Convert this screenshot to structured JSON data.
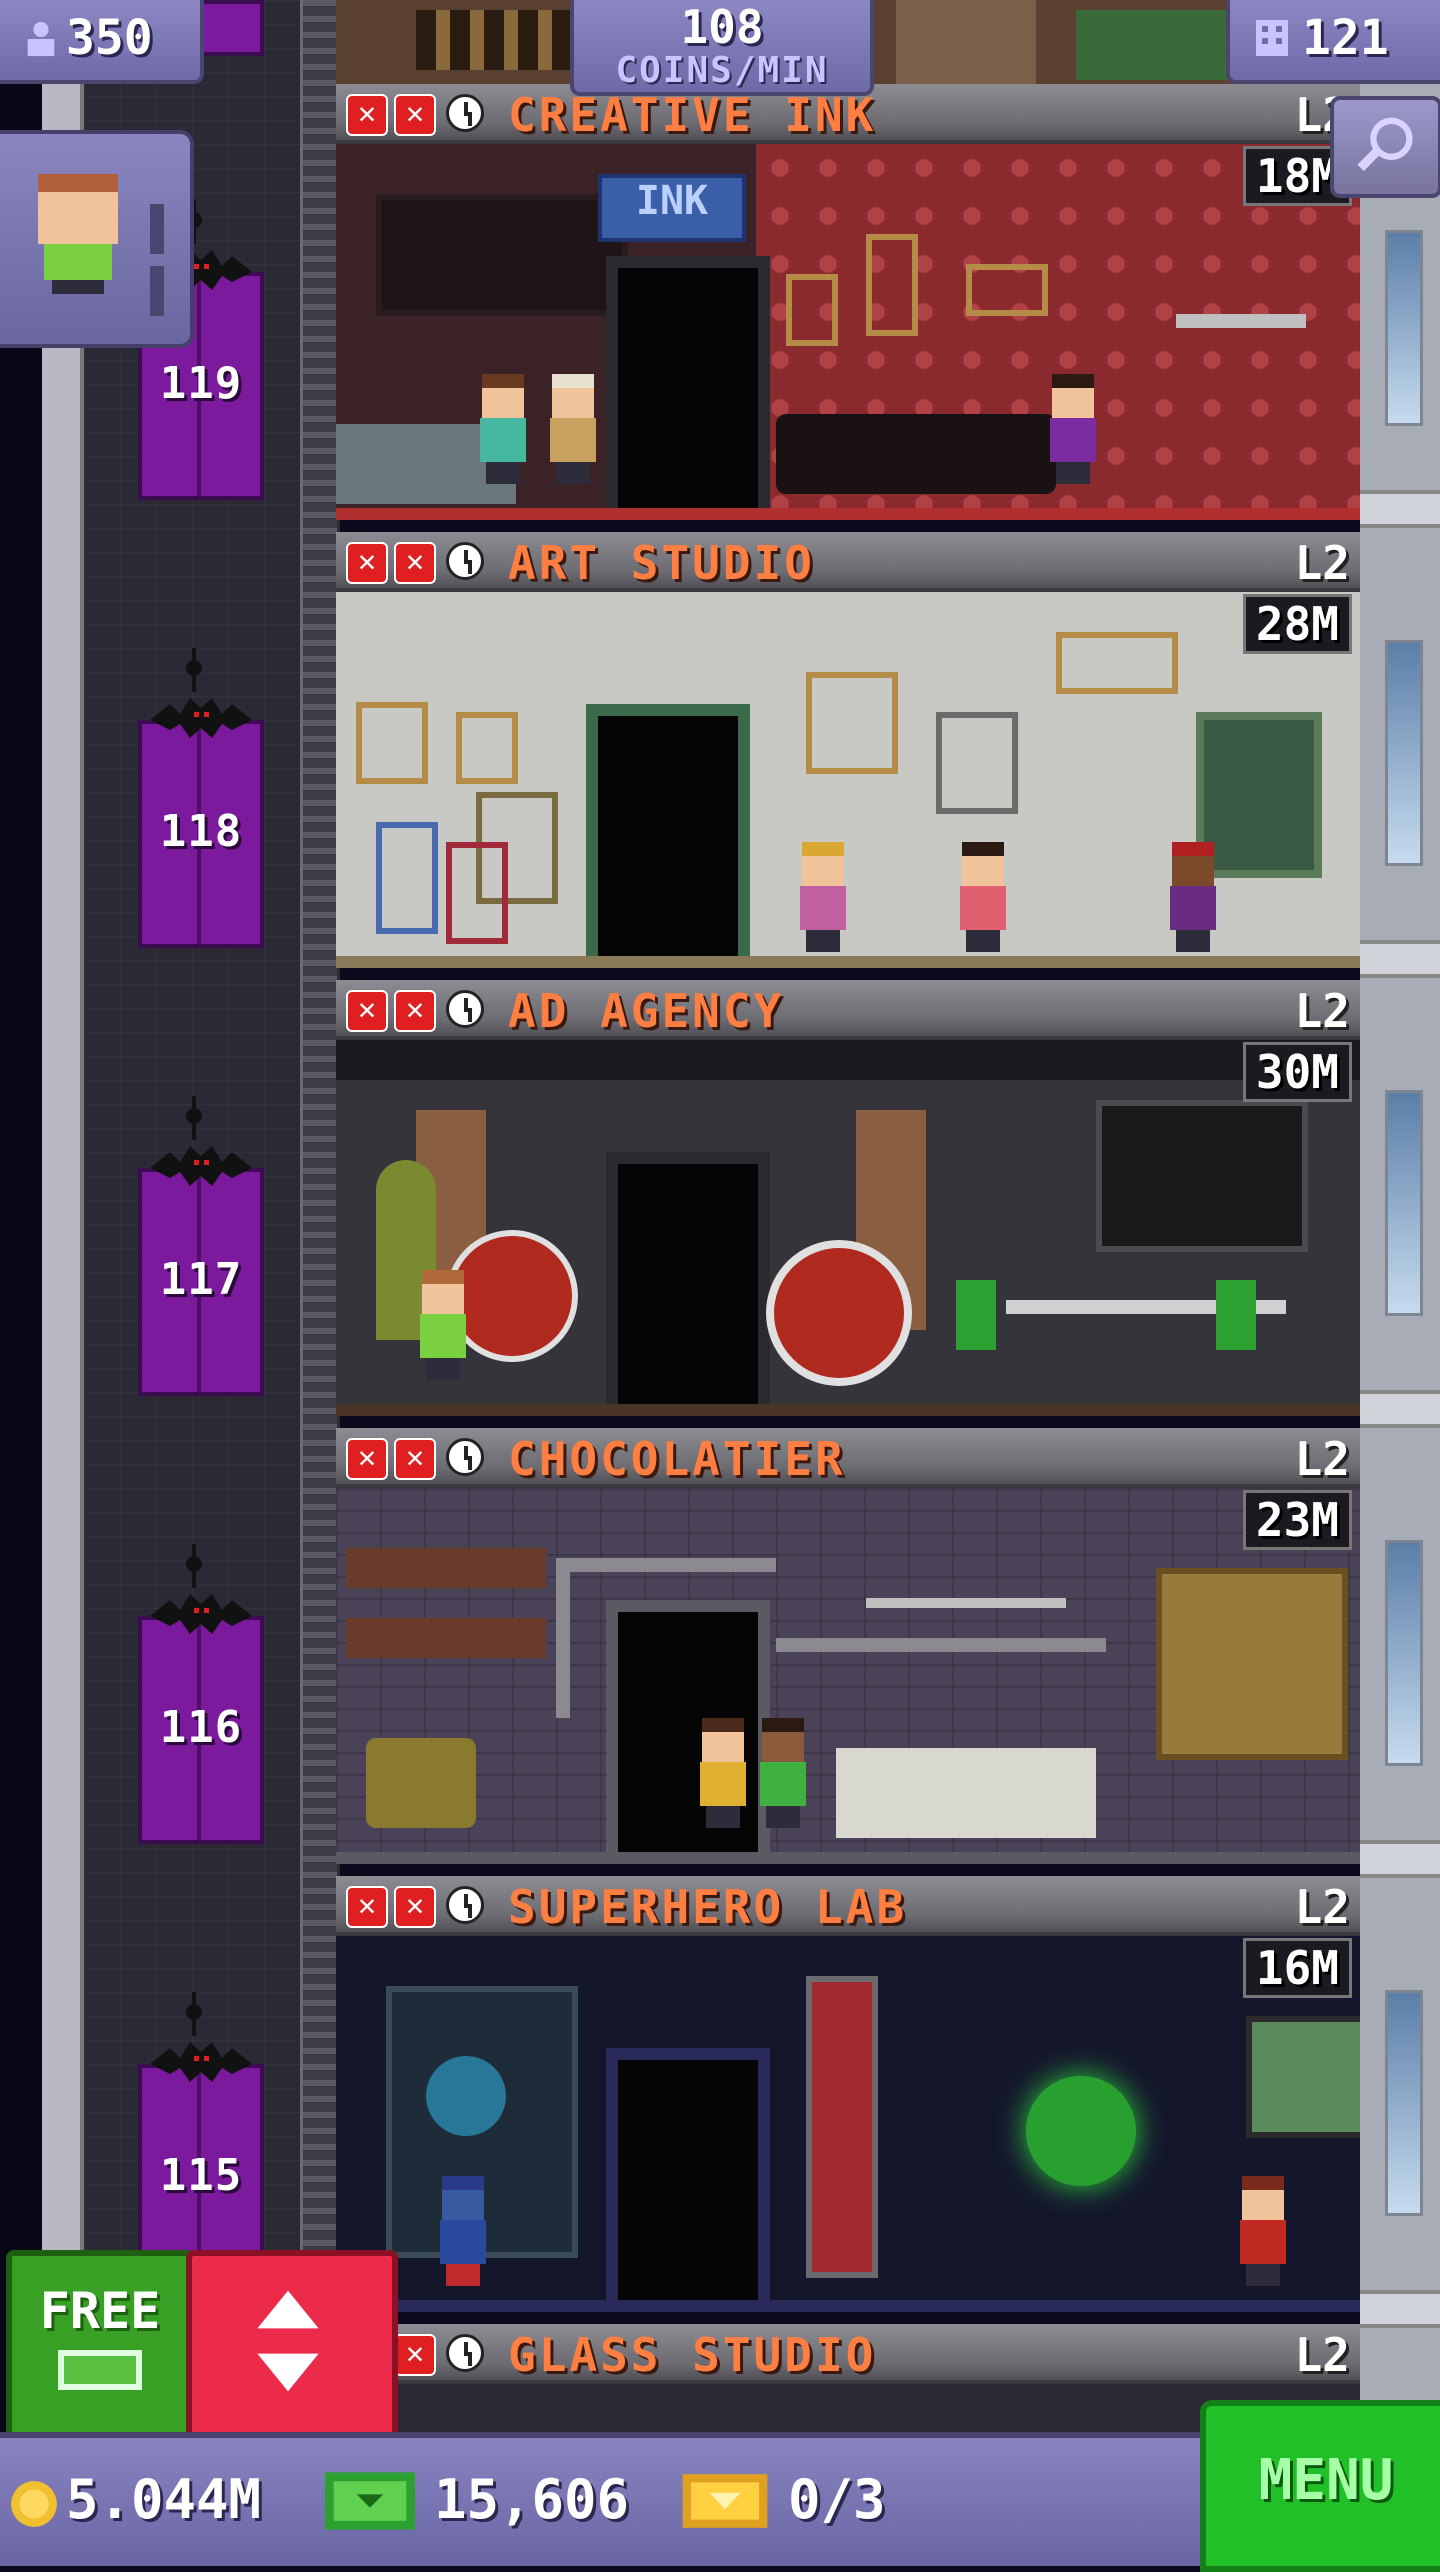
{
  "hud": {
    "population": "350",
    "coins_per_min_value": "108",
    "coins_per_min_label": "COINS/MIN",
    "floors_count": "121"
  },
  "floors": [
    {
      "name": "CREATIVE INK",
      "level": "L2",
      "income": "18M",
      "elevator_floor": "119"
    },
    {
      "name": "ART STUDIO",
      "level": "L2",
      "income": "28M",
      "elevator_floor": "118"
    },
    {
      "name": "AD AGENCY",
      "level": "L2",
      "income": "30M",
      "elevator_floor": "117"
    },
    {
      "name": "CHOCOLATIER",
      "level": "L2",
      "income": "23M",
      "elevator_floor": "116"
    },
    {
      "name": "SUPERHERO LAB",
      "level": "L2",
      "income": "16M",
      "elevator_floor": "115"
    },
    {
      "name": "GLASS STUDIO",
      "level": "L2"
    }
  ],
  "room_signs": {
    "ink_sign": "INK"
  },
  "buttons": {
    "free_label": "FREE",
    "menu_label": "MENU"
  },
  "bottom_bar": {
    "coins": "5.044M",
    "bux": "15,606",
    "tickets": "0/3"
  },
  "colors": {
    "accent_orange": "#ff7e42",
    "elevator_purple": "#7b1a9c",
    "hud_lavender": "#7e7ab6",
    "menu_green": "#22c028",
    "updown_red": "#ec2a4a"
  }
}
